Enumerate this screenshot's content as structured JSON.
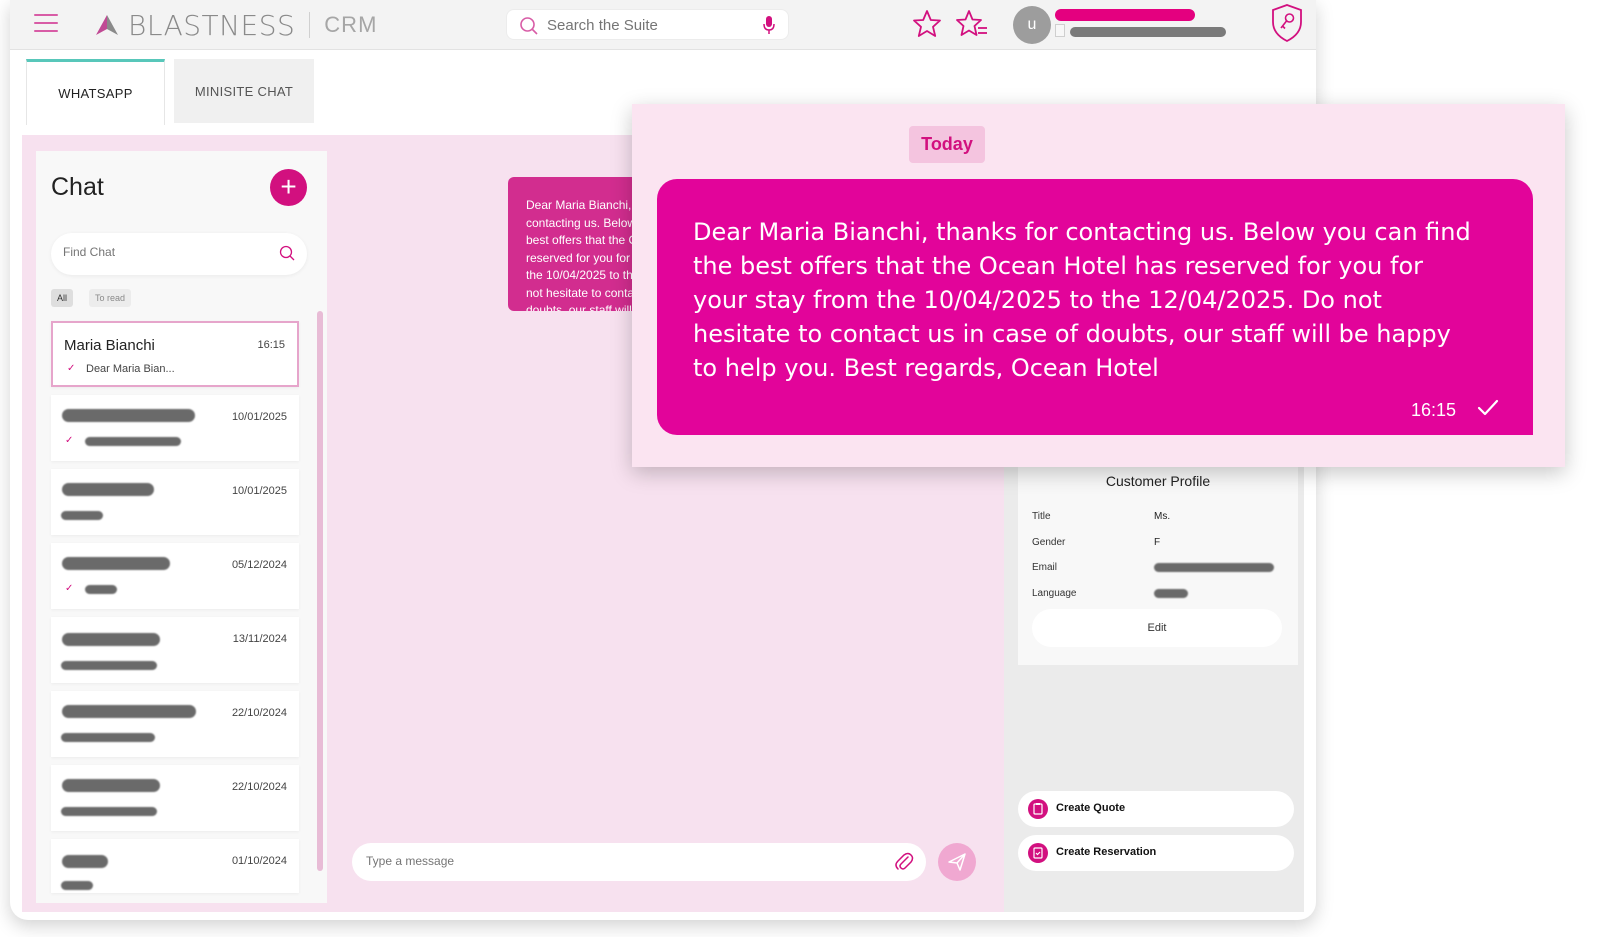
{
  "header": {
    "logo_text": "BLASTNESS",
    "logo_sub": "CRM",
    "search_placeholder": "Search the Suite",
    "avatar_letter": "u"
  },
  "tabs": [
    {
      "label": "WHATSAPP",
      "active": true
    },
    {
      "label": "MINISITE CHAT",
      "active": false
    }
  ],
  "chat": {
    "title": "Chat",
    "add_label": "+",
    "find_placeholder": "Find Chat",
    "filters": [
      "All",
      "To read"
    ],
    "items": [
      {
        "name": "Maria Bianchi",
        "time": "16:15",
        "preview": "Dear Maria Bian...",
        "selected": true
      },
      {
        "time": "10/01/2025"
      },
      {
        "time": "10/01/2025"
      },
      {
        "time": "05/12/2024"
      },
      {
        "time": "13/11/2024"
      },
      {
        "time": "22/10/2024"
      },
      {
        "time": "22/10/2024"
      },
      {
        "time": "01/10/2024"
      }
    ]
  },
  "conversation": {
    "message_preview": "Dear Maria Bianchi, thanks for contacting us. Below you can find the best offers that the Ocean Hotel has reserved for you for your stay from the 10/04/2025 to the 12/04/2025. Do not hesitate to contact us in case of doubts, our staff will be happy to help you. Best regards, Ocean Hotel",
    "input_placeholder": "Type a message"
  },
  "popup": {
    "date_label": "Today",
    "message": "Dear Maria Bianchi, thanks for contacting us. Below you can find the best offers that the Ocean Hotel has reserved for you for your stay from the 10/04/2025 to the 12/04/2025. Do not hesitate to contact us in case of doubts, our staff will be happy to help you. Best regards, Ocean Hotel",
    "time": "16:15"
  },
  "profile": {
    "title": "Customer Profile",
    "fields": [
      {
        "label": "Title",
        "value": "Ms."
      },
      {
        "label": "Gender",
        "value": "F"
      },
      {
        "label": "Email",
        "value": ""
      },
      {
        "label": "Language",
        "value": ""
      }
    ],
    "edit_label": "Edit"
  },
  "actions": {
    "create_quote": "Create Quote",
    "create_reservation": "Create Reservation"
  },
  "colors": {
    "brand": "#e2049a",
    "brand_dark": "#d2107f",
    "workspace_bg": "#f7e1ef",
    "tab_accent": "#58c7ba"
  }
}
